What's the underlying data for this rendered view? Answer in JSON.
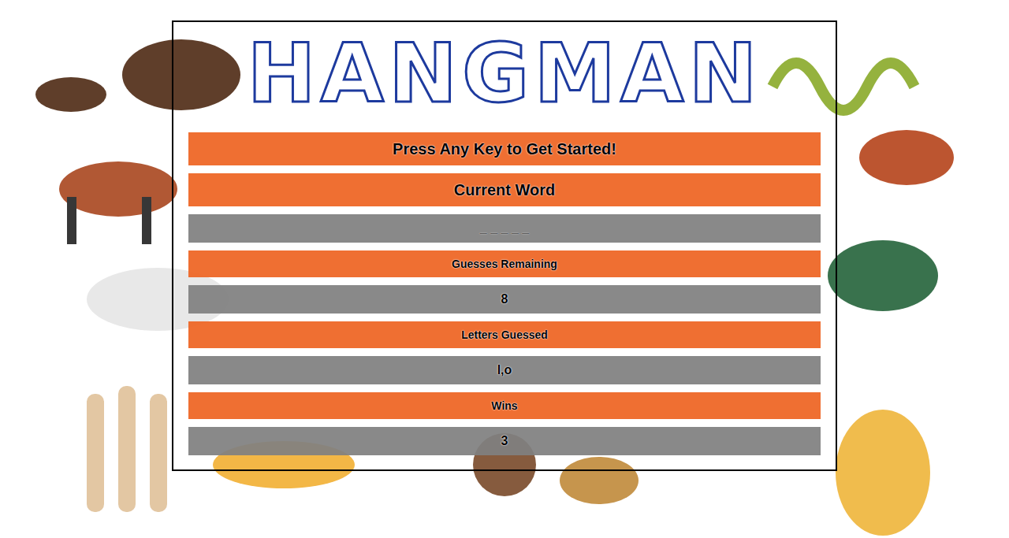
{
  "title": "HANGMAN",
  "prompt": "Press Any Key to Get Started!",
  "current_word": {
    "label": "Current Word",
    "value": "_ _ _ _ _"
  },
  "stats": [
    {
      "label": "Guesses Remaining",
      "value": "8"
    },
    {
      "label": "Letters Guessed",
      "value": "l,o"
    },
    {
      "label": "Wins",
      "value": "3"
    }
  ]
}
